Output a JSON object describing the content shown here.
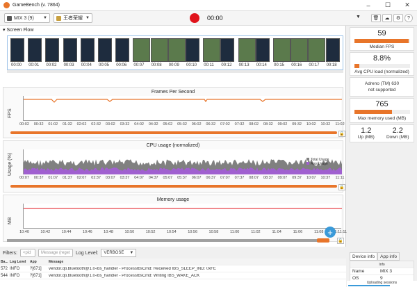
{
  "window": {
    "title": "GameBench (v. 7864)"
  },
  "toolbar": {
    "device": "MIX 3 (9)",
    "app": "王者荣耀",
    "timer": "00:00"
  },
  "screen_flow": {
    "label": "Screen Flow",
    "thumbs": [
      "00:00",
      "00:01",
      "00:02",
      "00:03",
      "00:04",
      "00:05",
      "00:06",
      "00:07",
      "00:08",
      "00:09",
      "00:10",
      "00:11",
      "00:12",
      "00:13",
      "00:14",
      "00:15",
      "00:16",
      "00:17",
      "00:18"
    ]
  },
  "fps": {
    "title": "Frames Per Second",
    "ylabel": "FPS",
    "yticks": [
      "60",
      "45",
      "30",
      "15",
      "0"
    ],
    "xticks": [
      "00:02",
      "00:32",
      "01:02",
      "01:32",
      "02:02",
      "02:32",
      "03:02",
      "03:32",
      "04:02",
      "04:32",
      "05:02",
      "05:32",
      "06:02",
      "06:32",
      "07:02",
      "07:32",
      "08:02",
      "08:32",
      "09:02",
      "09:32",
      "10:02",
      "10:32",
      "11:02"
    ],
    "color": "#e8752a"
  },
  "cpu": {
    "title": "CPU usage (normalized)",
    "ylabel": "Usage (%)",
    "yticks": [
      "40",
      "30",
      "20",
      "10",
      "0"
    ],
    "xticks": [
      "00:07",
      "00:37",
      "01:07",
      "01:37",
      "02:07",
      "02:37",
      "03:07",
      "03:37",
      "04:07",
      "04:37",
      "05:07",
      "05:37",
      "06:07",
      "06:37",
      "07:07",
      "07:37",
      "08:07",
      "08:37",
      "09:07",
      "09:37",
      "10:07",
      "10:37",
      "11:11"
    ],
    "legend": [
      "Total Usage",
      "App Usage"
    ],
    "colors": [
      "#808080",
      "#a060d0"
    ]
  },
  "memory": {
    "title": "Memory usage",
    "ylabel": "MB",
    "yticks": [
      "841.3",
      "800",
      "600",
      "400",
      "200",
      "0"
    ],
    "xticks": [
      "10:40",
      "10:42",
      "10:44",
      "10:46",
      "10:48",
      "10:50",
      "10:52",
      "10:54",
      "10:56",
      "10:58",
      "11:00",
      "11:02",
      "11:04",
      "11:06",
      "11:08",
      "11:11:11"
    ],
    "color": "#e0131b"
  },
  "filters": {
    "label": "Filters:",
    "pid_placeholder": "<pid",
    "message_placeholder": "Message (reget",
    "log_level_label": "Log Level:",
    "log_level": "VERBOSE"
  },
  "log": {
    "headers": [
      "Ba...",
      "Log Level",
      "App",
      "Message"
    ],
    "rows": [
      [
        "572",
        "INFO",
        "?[671]",
        "vendor.qti.bluetooth@1.0-ibs_handler - ProcessIbsCmd: Received IBS_SLEEP_IND: 0xFE"
      ],
      [
        "544",
        "INFO",
        "?[671]",
        "vendor.qti.bluetooth@1.0-ibs_handler - ProcessIbsCmd: Writing IBS_WAKE_ACK"
      ]
    ]
  },
  "sidebar": {
    "median_fps": {
      "value": "59",
      "label": "Median FPS",
      "level": 0.98
    },
    "cpu_load": {
      "value": "8.8%",
      "label": "Avg CPU load (normalized)",
      "level": 0.09
    },
    "gpu": {
      "line1": "Adreno (TM) 630",
      "line2": "not supported"
    },
    "memory": {
      "value": "765",
      "label": "Max memory used (MB)",
      "level": 0.68
    },
    "up": {
      "value": "1.2",
      "label": "Up (MB)"
    },
    "down": {
      "value": "2.2",
      "label": "Down (MB)"
    },
    "tabs": [
      "Device info",
      "App info"
    ],
    "info_header": "Info",
    "info_rows": [
      [
        "Name",
        "MIX 3"
      ],
      [
        "OS",
        "9"
      ]
    ],
    "upload_status": "Uploading sessions"
  }
}
